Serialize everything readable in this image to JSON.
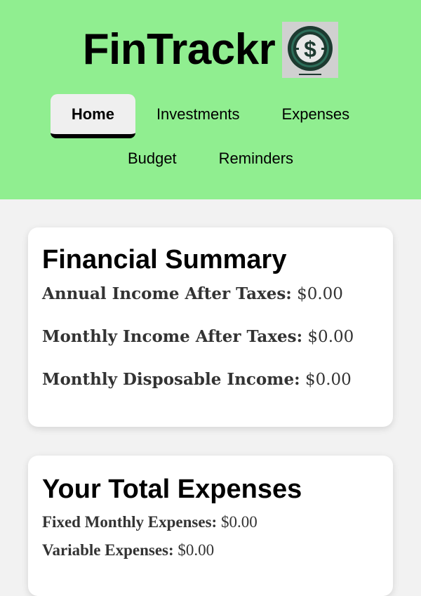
{
  "header": {
    "title": "FinTrackr",
    "logo_icon": "dollar-coin-icon",
    "background": "#90ee90"
  },
  "nav": {
    "items": [
      {
        "label": "Home",
        "active": true
      },
      {
        "label": "Investments",
        "active": false
      },
      {
        "label": "Expenses",
        "active": false
      },
      {
        "label": "Budget",
        "active": false
      },
      {
        "label": "Reminders",
        "active": false
      }
    ]
  },
  "summary": {
    "title": "Financial Summary",
    "rows": [
      {
        "label": "Annual Income After Taxes:",
        "value": "$0.00"
      },
      {
        "label": "Monthly Income After Taxes:",
        "value": "$0.00"
      },
      {
        "label": "Monthly Disposable Income:",
        "value": "$0.00"
      }
    ]
  },
  "expenses": {
    "title": "Your Total Expenses",
    "rows": [
      {
        "label": "Fixed Monthly Expenses:",
        "value": "$0.00"
      },
      {
        "label": "Variable Expenses:",
        "value": "$0.00"
      }
    ]
  }
}
